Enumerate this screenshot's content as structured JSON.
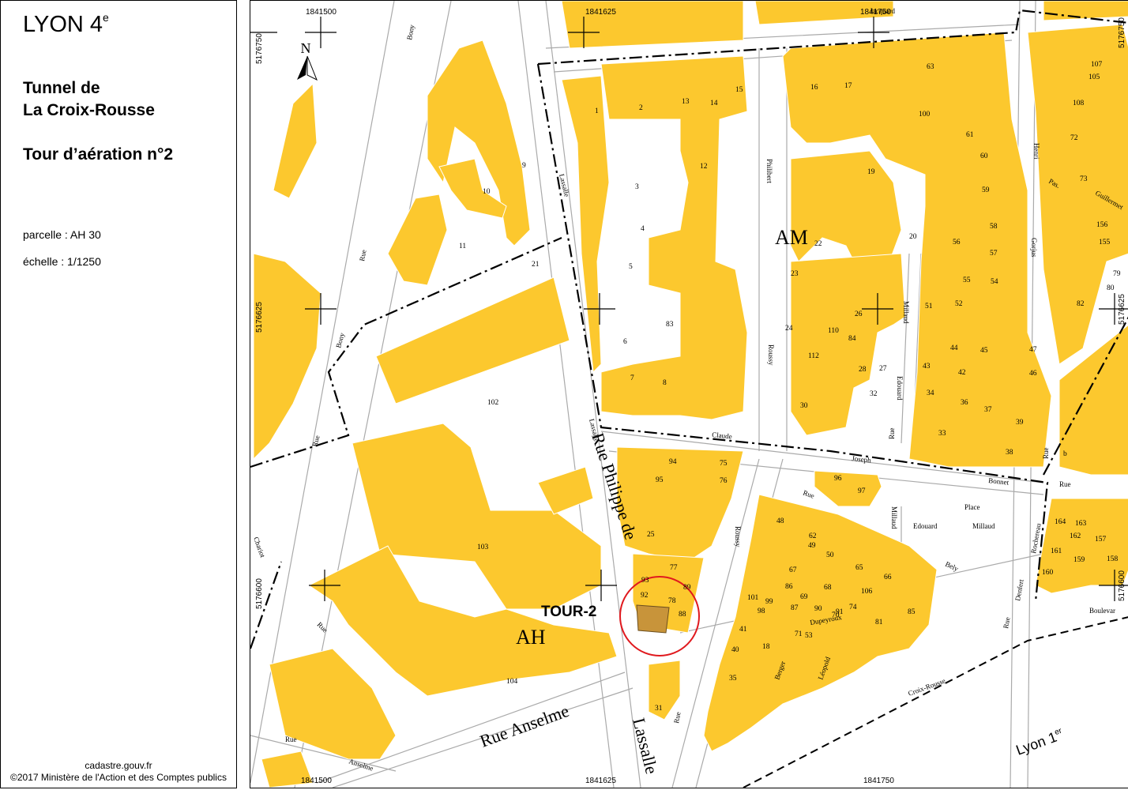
{
  "panel": {
    "city": "LYON 4",
    "city_sup": "e",
    "title_line1": "Tunnel de",
    "title_line2": "La Croix-Rousse",
    "subtitle": "Tour d’aération n°2",
    "parcel": "parcelle : AH 30",
    "scale": "échelle : 1/1250",
    "source": "cadastre.gouv.fr",
    "copyright": "©2017 Ministère de l'Action et des Comptes publics"
  },
  "map": {
    "marker_label": "TOUR-2",
    "sections": [
      "AM",
      "AH"
    ],
    "north": "N",
    "lyon1": "Lyon 1",
    "lyon1_sup": "er",
    "coords": {
      "x1": "1841500",
      "x2": "1841625",
      "x3": "1841750",
      "y1": "5176750",
      "y2": "5176625",
      "y3": "5176600"
    },
    "streets": {
      "rue_philippe": "Rue  Philippe  de",
      "lassalle": "Lassalle",
      "rue_anselme": "Rue  Anselme",
      "anselme_small": "Anselme",
      "rue_small": "Rue",
      "jacquard": "Jacquard",
      "claude": "Claude",
      "joseph": "Joseph",
      "bonnet": "Bonnet",
      "philibert": "Philibert",
      "roussy": "Roussy",
      "edouard": "Edouard",
      "millaud": "Millaud",
      "place": "Place",
      "bely": "Bely",
      "henri": "Henri",
      "gorjus": "Gorjus",
      "boulevar": "Boulevar",
      "croix_rousse": "Croix-Rousse",
      "dupeyroux": "Dupeyroux",
      "berger": "Berger",
      "leopold": "Léopold",
      "denfert": "Denfert",
      "rochereau": "Rochereau",
      "bony": "Bony",
      "chariot": "Chariot",
      "pas": "Pas.",
      "guillotiere": "Guillermet"
    },
    "parcel_numbers": [
      "1",
      "2",
      "3",
      "4",
      "5",
      "6",
      "7",
      "8",
      "9",
      "10",
      "11",
      "12",
      "13",
      "14",
      "15",
      "16",
      "17",
      "18",
      "19",
      "20",
      "21",
      "22",
      "23",
      "24",
      "25",
      "26",
      "27",
      "28",
      "30",
      "31",
      "32",
      "33",
      "34",
      "35",
      "36",
      "37",
      "38",
      "39",
      "40",
      "41",
      "42",
      "43",
      "44",
      "45",
      "46",
      "47",
      "48",
      "49",
      "50",
      "51",
      "52",
      "53",
      "54",
      "55",
      "56",
      "57",
      "58",
      "59",
      "60",
      "61",
      "62",
      "63",
      "65",
      "66",
      "67",
      "68",
      "69",
      "70",
      "71",
      "72",
      "73",
      "74",
      "75",
      "76",
      "77",
      "78",
      "79",
      "80",
      "81",
      "82",
      "83",
      "84",
      "85",
      "86",
      "87",
      "88",
      "89",
      "90",
      "91",
      "92",
      "93",
      "94",
      "95",
      "96",
      "97",
      "98",
      "99",
      "100",
      "101",
      "102",
      "103",
      "104",
      "105",
      "106",
      "107",
      "108",
      "110",
      "112",
      "155",
      "156",
      "157",
      "158",
      "159",
      "160",
      "161",
      "162",
      "163",
      "164",
      "b"
    ]
  },
  "colors": {
    "building": "#FCC82E",
    "highlight": "#C8943A",
    "circle": "#E0191E",
    "road_line": "#999999",
    "boundary": "#000000"
  }
}
